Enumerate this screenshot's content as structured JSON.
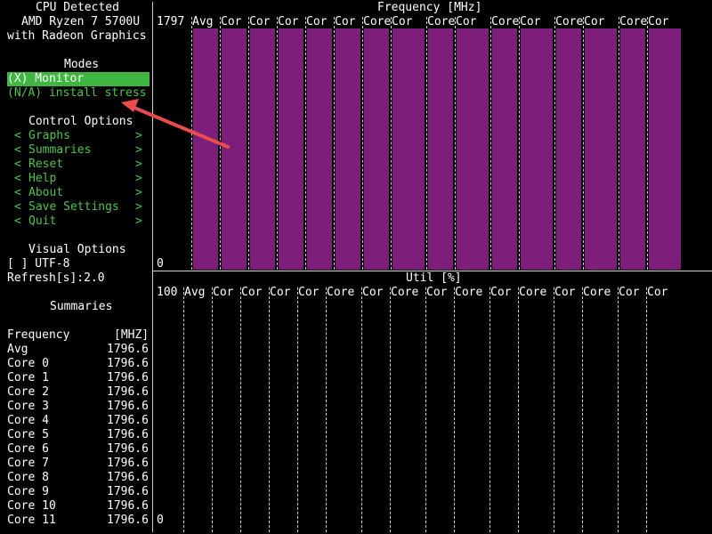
{
  "sidebar": {
    "cpu_title": "CPU Detected",
    "cpu_name_1": "AMD Ryzen 7 5700U",
    "cpu_name_2": "with Radeon Graphics",
    "modes_title": "Modes",
    "modes": [
      {
        "label": "(X) Monitor",
        "selected": true
      },
      {
        "label": "(N/A) install stress",
        "selected": false
      }
    ],
    "control_title": "Control Options",
    "controls": [
      {
        "label": "Graphs"
      },
      {
        "label": "Summaries"
      },
      {
        "label": "Reset"
      },
      {
        "label": "Help"
      },
      {
        "label": "About"
      },
      {
        "label": "Save Settings"
      },
      {
        "label": "Quit"
      }
    ],
    "arrow_left": "<",
    "arrow_right": ">",
    "visual_title": "Visual Options",
    "utf8_option": "[ ] UTF-8",
    "refresh": "Refresh[s]:2.0"
  },
  "summaries": {
    "title": "Summaries",
    "header_label": "Frequency",
    "header_unit": "[MHZ]",
    "rows": [
      {
        "label": "Avg",
        "value": "1796.6"
      },
      {
        "label": "Core 0",
        "value": "1796.6"
      },
      {
        "label": "Core 1",
        "value": "1796.6"
      },
      {
        "label": "Core 2",
        "value": "1796.6"
      },
      {
        "label": "Core 3",
        "value": "1796.6"
      },
      {
        "label": "Core 4",
        "value": "1796.6"
      },
      {
        "label": "Core 5",
        "value": "1796.6"
      },
      {
        "label": "Core 6",
        "value": "1796.6"
      },
      {
        "label": "Core 7",
        "value": "1796.6"
      },
      {
        "label": "Core 8",
        "value": "1796.6"
      },
      {
        "label": "Core 9",
        "value": "1796.6"
      },
      {
        "label": "Core 10",
        "value": "1796.6"
      },
      {
        "label": "Core 11",
        "value": "1796.6"
      }
    ]
  },
  "freq_graph": {
    "title": "Frequency [MHz]",
    "y_max": "1797",
    "y_min": "0",
    "columns": [
      "Avg",
      "Cor",
      "Cor",
      "Cor",
      "Cor",
      "Cor",
      "Core",
      "Cor",
      "Core",
      "Cor",
      "Core",
      "Cor",
      "Core",
      "Cor",
      "Core",
      "Cor"
    ],
    "fill_fraction": 1.0,
    "bar_color": "#7d1f7a"
  },
  "util_graph": {
    "title": "Util [%]",
    "y_max": "100",
    "y_min": "0",
    "columns": [
      "Avg",
      "Cor",
      "Cor",
      "Cor",
      "Cor",
      "Core",
      "Cor",
      "Core",
      "Cor",
      "Core",
      "Cor",
      "Core",
      "Cor",
      "Core",
      "Cor",
      "Cor"
    ],
    "fill_fraction": 0.0
  },
  "colors": {
    "accent_green": "#3fb63f",
    "text_green": "#4ec24e",
    "annotation_red": "#e84c4c"
  }
}
